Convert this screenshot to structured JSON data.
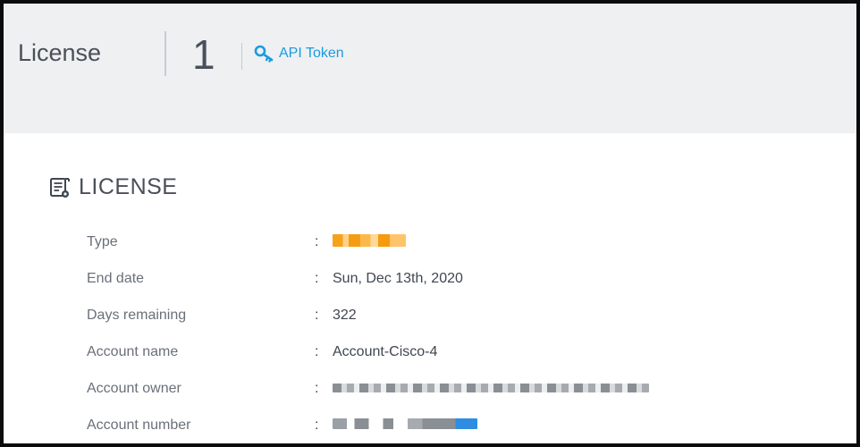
{
  "header": {
    "title": "License",
    "count": "1",
    "api_token_label": "API Token",
    "icon": "key-icon"
  },
  "section": {
    "icon": "license-doc-icon",
    "title": "LICENSE"
  },
  "rows": [
    {
      "label": "Type",
      "value": "",
      "redacted": true
    },
    {
      "label": "End date",
      "value": "Sun, Dec 13th, 2020"
    },
    {
      "label": "Days remaining",
      "value": "322"
    },
    {
      "label": "Account name",
      "value": "Account-Cisco-4"
    },
    {
      "label": "Account owner",
      "value": "",
      "redacted": true
    },
    {
      "label": "Account number",
      "value": "",
      "redacted": true
    }
  ],
  "colon": ":",
  "colors": {
    "accent": "#1a9be0",
    "header_bg": "#eef0f2",
    "frame": "#0b0b0b"
  }
}
